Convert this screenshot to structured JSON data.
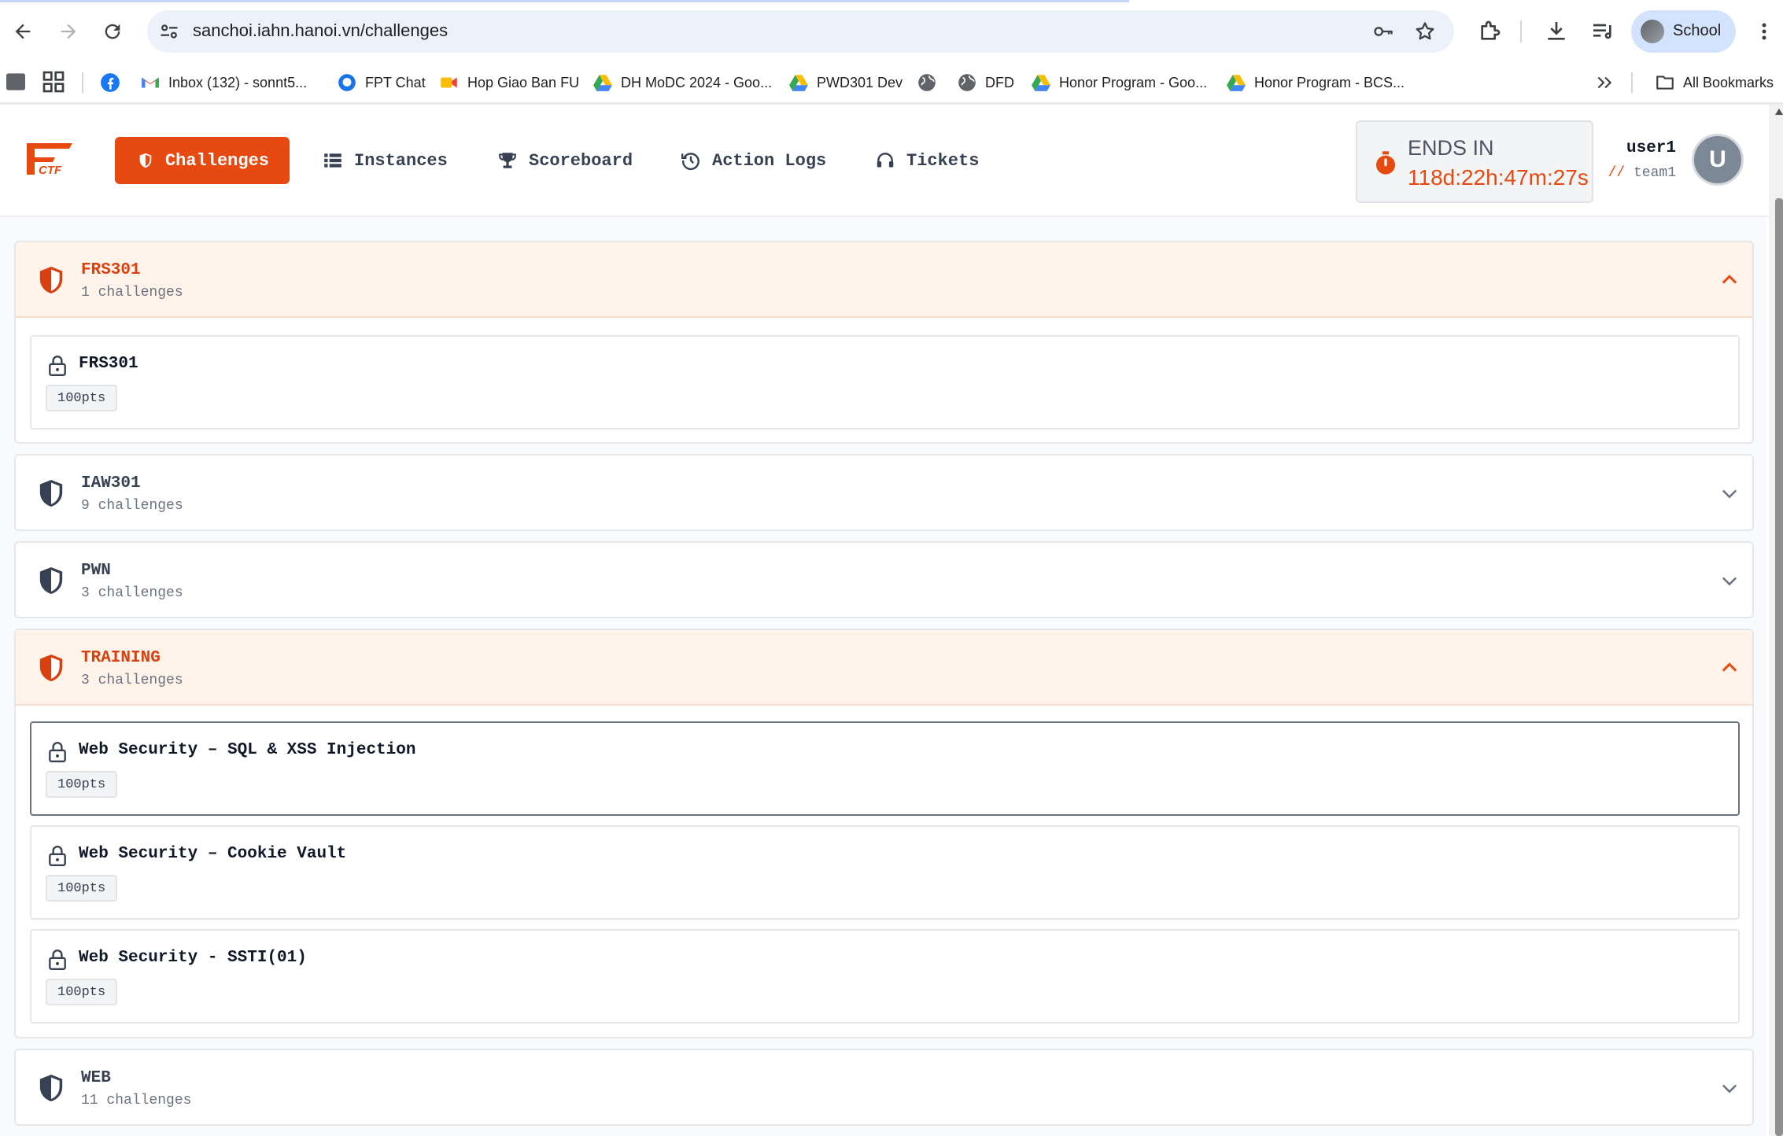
{
  "browser": {
    "url": "sanchoi.iahn.hanoi.vn/challenges",
    "profile_name": "School",
    "bookmarks": [
      {
        "label": "Inbox (132) - sonnt5...",
        "icon": "gmail-icon"
      },
      {
        "label": "FPT Chat",
        "icon": "chat-icon"
      },
      {
        "label": "Hop Giao Ban FU",
        "icon": "meet-icon"
      },
      {
        "label": "DH MoDC 2024 - Goo...",
        "icon": "drive-icon"
      },
      {
        "label": "PWD301 Dev",
        "icon": "drive-icon"
      },
      {
        "label": "DFD",
        "icon": "globe-icon"
      },
      {
        "label": "Honor Program - Goo...",
        "icon": "drive-icon"
      },
      {
        "label": "Honor Program - BCS...",
        "icon": "drive-icon"
      }
    ],
    "all_bookmarks_label": "All Bookmarks"
  },
  "header": {
    "nav": [
      {
        "label": "Challenges",
        "icon": "shield-icon",
        "active": true
      },
      {
        "label": "Instances",
        "icon": "list-icon",
        "active": false
      },
      {
        "label": "Scoreboard",
        "icon": "trophy-icon",
        "active": false
      },
      {
        "label": "Action Logs",
        "icon": "history-icon",
        "active": false
      },
      {
        "label": "Tickets",
        "icon": "headset-icon",
        "active": false
      }
    ],
    "timer": {
      "label": "ENDS IN",
      "value": "118d:22h:47m:27s"
    },
    "user": {
      "name": "user1",
      "team_prefix": "//",
      "team": "team1",
      "avatar_letter": "U"
    }
  },
  "categories": [
    {
      "title": "FRS301",
      "count": "1 challenges",
      "expanded": true,
      "challenges": [
        {
          "title": "FRS301",
          "points": "100pts"
        }
      ]
    },
    {
      "title": "IAW301",
      "count": "9 challenges",
      "expanded": false,
      "challenges": []
    },
    {
      "title": "PWN",
      "count": "3 challenges",
      "expanded": false,
      "challenges": []
    },
    {
      "title": "TRAINING",
      "count": "3 challenges",
      "expanded": true,
      "challenges": [
        {
          "title": "Web Security – SQL & XSS Injection",
          "points": "100pts"
        },
        {
          "title": "Web Security – Cookie Vault",
          "points": "100pts"
        },
        {
          "title": "Web Security - SSTI(01)",
          "points": "100pts"
        }
      ]
    },
    {
      "title": "WEB",
      "count": "11 challenges",
      "expanded": false,
      "challenges": []
    }
  ],
  "colors": {
    "accent": "#e64a10",
    "open_header_bg": "#fff3ea",
    "dark_icon": "#374151"
  }
}
